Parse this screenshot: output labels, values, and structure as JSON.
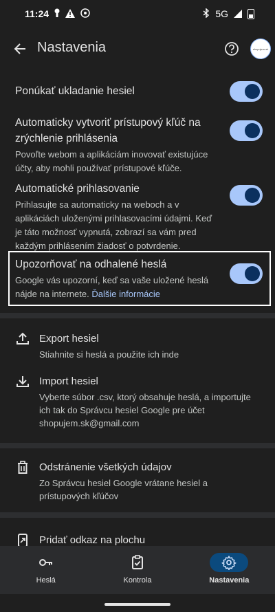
{
  "status": {
    "time": "11:24",
    "network": "5G"
  },
  "appbar": {
    "title": "Nastavenia",
    "avatar_text": "shopujem.sk"
  },
  "settings": [
    {
      "title": "Ponúkať ukladanie hesiel",
      "desc": "",
      "enabled": true
    },
    {
      "title": "Automaticky vytvoriť prístupový kľúč na zrýchlenie prihlásenia",
      "desc": "Povoľte webom a aplikáciám inovovať existujúce účty, aby mohli používať prístupové kľúče.",
      "enabled": true
    },
    {
      "title": "Automatické prihlasovanie",
      "desc": "Prihlasujte sa automaticky na weboch a v aplikáciách uloženými prihlasovacími údajmi. Keď je táto možnosť vypnutá, zobrazí sa vám pred každým prihlásením žiadosť o potvrdenie.",
      "enabled": true
    },
    {
      "title": "Upozorňovať na odhalené heslá",
      "desc": "Google vás upozorní, keď sa vaše uložené heslá nájde na internete.",
      "link": "Ďalšie informácie",
      "enabled": true
    }
  ],
  "actions": {
    "export": {
      "title": "Export hesiel",
      "desc": "Stiahnite si heslá a použite ich inde",
      "icon": "upload-icon"
    },
    "import": {
      "title": "Import hesiel",
      "desc": "Vyberte súbor .csv, ktorý obsahuje heslá, a importujte ich tak do Správcu hesiel Google pre účet shopujem.sk@gmail.com",
      "icon": "download-icon"
    },
    "delete": {
      "title": "Odstránenie všetkých údajov",
      "desc": "Zo Správcu hesiel Google vrátane hesiel a prístupových kľúčov",
      "icon": "trash-icon"
    },
    "shortcut": {
      "title": "Pridať odkaz na plochu",
      "icon": "add-to-home-icon"
    }
  },
  "nav": [
    {
      "label": "Heslá",
      "icon": "key-icon",
      "active": false
    },
    {
      "label": "Kontrola",
      "icon": "clipboard-check-icon",
      "active": false
    },
    {
      "label": "Nastavenia",
      "icon": "gear-icon",
      "active": true
    }
  ],
  "colors": {
    "background": "#1f1f1f",
    "accent": "#a8c7fa",
    "toggle_knob": "#0b305f",
    "nav_active": "#0b4a7e"
  }
}
